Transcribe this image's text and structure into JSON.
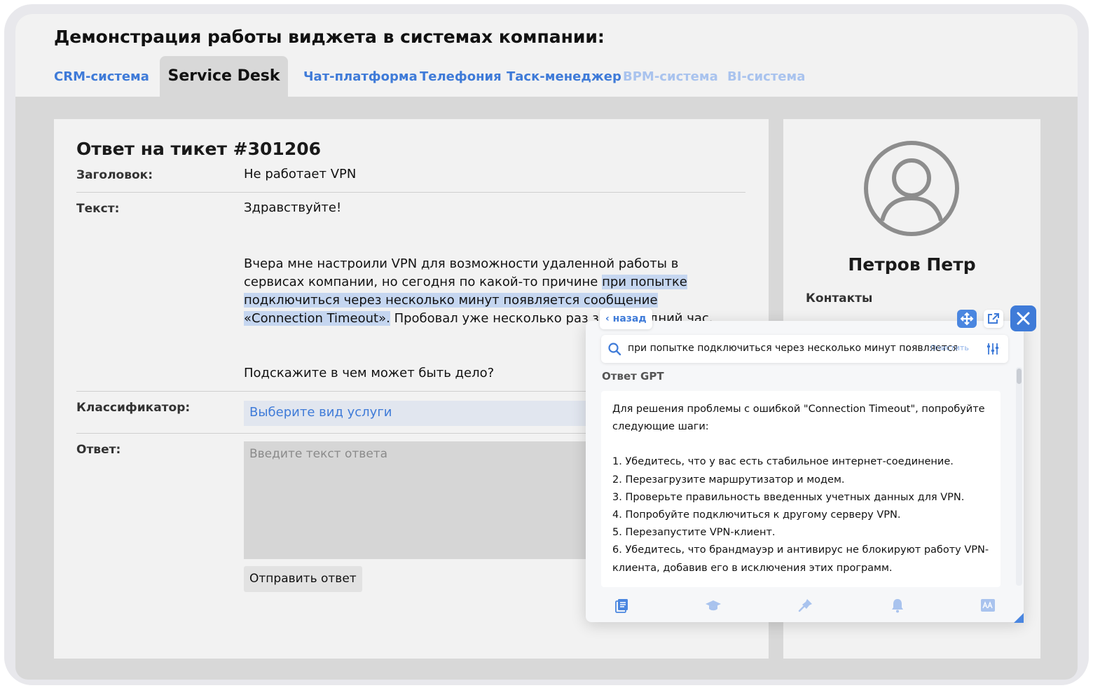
{
  "header": {
    "title": "Демонстрация работы виджета в системах компании:",
    "tabs": [
      {
        "label": "CRM-система",
        "state": "link"
      },
      {
        "label": "Service Desk",
        "state": "active"
      },
      {
        "label": "Чат-платформа",
        "state": "link"
      },
      {
        "label": "Телефония",
        "state": "link"
      },
      {
        "label": "Таск-менеджер",
        "state": "link"
      },
      {
        "label": "BPM-система",
        "state": "disabled"
      },
      {
        "label": "BI-система",
        "state": "disabled"
      }
    ]
  },
  "ticket": {
    "title": "Ответ на тикет #301206",
    "subject_label": "Заголовок:",
    "subject": "Не работает VPN",
    "text_label": "Текст:",
    "greeting": "Здравствуйте!",
    "body_part1": "Вчера мне настроили VPN для возможности удаленной работы в сервисах компании, но сегодня по какой-то причине ",
    "body_highlight": "при попытке подключиться через несколько минут появляется сообщение «Connection Timeout».",
    "body_part2": " Пробовал уже несколько раз за последний час.",
    "question": "Подскажите в чем может быть дело?",
    "classifier_label": "Классификатор:",
    "classifier_value": "Выберите вид услуги",
    "answer_label": "Ответ:",
    "answer_placeholder": "Введите текст ответа",
    "send_label": "Отправить ответ"
  },
  "profile": {
    "name": "Петров Петр",
    "contacts_label": "Контакты"
  },
  "widget": {
    "back_label": "‹ назад",
    "search_text": "при попытке подключиться через несколько минут появляется сообщение «Connection Timeout».",
    "clear_label": "Очистить",
    "gpt_label": "Ответ GPT",
    "answer_intro": "Для решения проблемы с ошибкой \"Connection Timeout\", попробуйте следующие шаги:",
    "steps": [
      "1. Убедитесь, что у вас есть стабильное интернет-соединение.",
      "2. Перезагрузите маршрутизатор и модем.",
      "3. Проверьте правильность введенных учетных данных для VPN.",
      "4. Попробуйте подключиться к другому серверу VPN.",
      "5. Перезапустите VPN-клиент.",
      "6. Убедитесь, что брандмауэр и антивирус не блокируют работу VPN-клиента, добавив его в исключения этих программ."
    ],
    "bottom_nav": [
      "book-icon",
      "graduation-cap-icon",
      "pin-icon",
      "bell-icon",
      "text-size-icon"
    ]
  },
  "colors": {
    "accent": "#3f7bd8",
    "accent_dim": "#a9c3ee",
    "highlight": "#c5d6f0",
    "panel": "#f2f2f2",
    "backdrop": "#d8d8d8"
  }
}
